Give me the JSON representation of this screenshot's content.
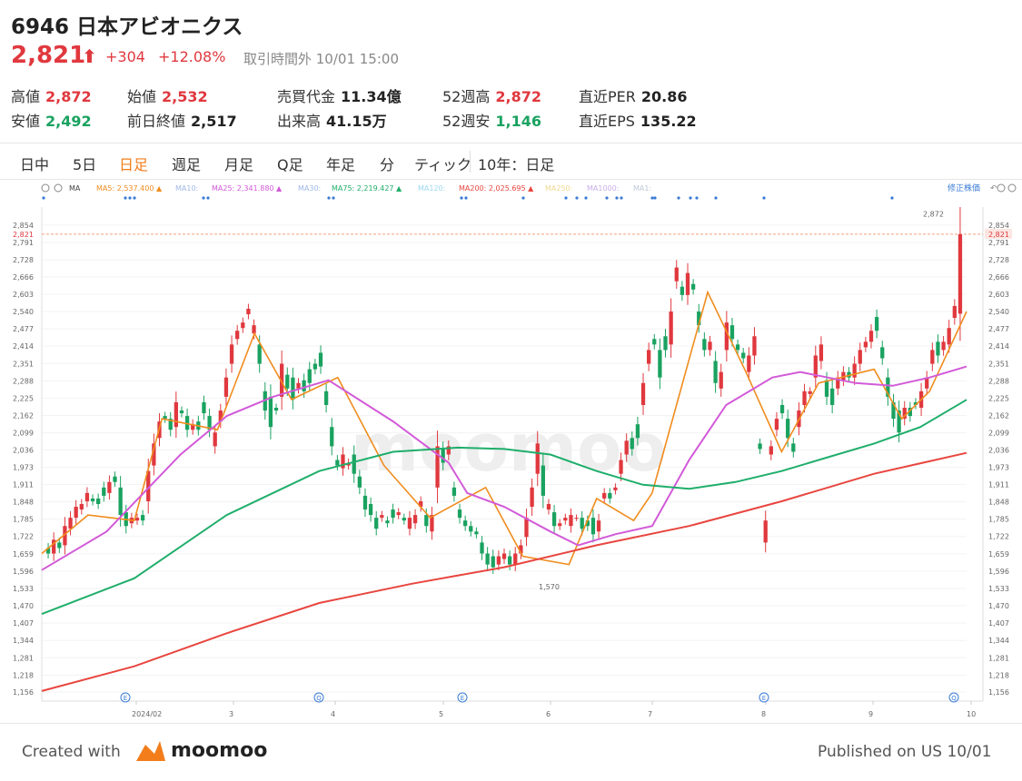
{
  "header": {
    "title": "6946 日本アビオニクス",
    "price": "2,821",
    "arrow": "⬆",
    "change": "+304",
    "change_pct": "+12.08%",
    "status": "取引時間外 10/01 15:00",
    "up_color": "#e0383e",
    "down_color": "#1aa260"
  },
  "stats": [
    {
      "label": "高値",
      "value": "2,872",
      "tone": "up"
    },
    {
      "label": "始値",
      "value": "2,532",
      "tone": "up"
    },
    {
      "label": "売買代金",
      "value": "11.34億",
      "tone": "neutral"
    },
    {
      "label": "52週高",
      "value": "2,872",
      "tone": "up"
    },
    {
      "label": "直近PER",
      "value": "20.86",
      "tone": "neutral"
    },
    {
      "label": "安値",
      "value": "2,492",
      "tone": "down"
    },
    {
      "label": "前日終値",
      "value": "2,517",
      "tone": "neutral"
    },
    {
      "label": "出来高",
      "value": "41.15万",
      "tone": "neutral"
    },
    {
      "label": "52週安",
      "value": "1,146",
      "tone": "down"
    },
    {
      "label": "直近EPS",
      "value": "135.22",
      "tone": "neutral"
    }
  ],
  "tabs": [
    "日中",
    "5日",
    "日足",
    "週足",
    "月足",
    "Q足",
    "年足",
    "分",
    "ティック"
  ],
  "active_tab": "日足",
  "range_label": "10年：日足",
  "legend": {
    "ma_label": "MA",
    "items": [
      {
        "text": "MA5: 2,537.400 ▲",
        "color": "#f08c1e"
      },
      {
        "text": "MA10:",
        "color": "#9fb8e6"
      },
      {
        "text": "MA25: 2,341.880 ▲",
        "color": "#d25ad8"
      },
      {
        "text": "MA30:",
        "color": "#9fb8e6"
      },
      {
        "text": "MA75: 2,219.427 ▲",
        "color": "#1fae6a"
      },
      {
        "text": "MA120:",
        "color": "#9fd8f0"
      },
      {
        "text": "MA200: 2,025.695 ▲",
        "color": "#e8463f"
      },
      {
        "text": "MA250:",
        "color": "#f0d890"
      },
      {
        "text": "MA1000:",
        "color": "#c8b0e8"
      },
      {
        "text": "MA1:",
        "color": "#c0c8d8"
      }
    ],
    "adjusted": "修正株価"
  },
  "watermark": "moomoo",
  "footer": {
    "created": "Created with",
    "brand": "moomoo",
    "published": "Published on US 10/01"
  },
  "chart_data": {
    "type": "candlestick",
    "y_ticks": [
      "2,854",
      "2,791",
      "2,728",
      "2,666",
      "2,603",
      "2,540",
      "2,477",
      "2,414",
      "2,351",
      "2,288",
      "2,225",
      "2,162",
      "2,099",
      "2,036",
      "1,973",
      "1,911",
      "1,848",
      "1,785",
      "1,722",
      "1,659",
      "1,596",
      "1,533",
      "1,470",
      "1,407",
      "1,344",
      "1,281",
      "1,218",
      "1,156"
    ],
    "ylim": [
      1130,
      2900
    ],
    "x_labels": [
      "2024/02",
      "3",
      "4",
      "5",
      "6",
      "7",
      "8",
      "9",
      "10"
    ],
    "current_price": 2821,
    "current_price_label": "2,821",
    "annotations": [
      {
        "text": "2,872",
        "value": 2872
      },
      {
        "text": "1,570",
        "value": 1570
      }
    ],
    "event_markers": [
      "E",
      "Q",
      "E",
      "E",
      "Q"
    ],
    "candles_approx": [
      [
        1680,
        1660
      ],
      [
        1660,
        1710
      ],
      [
        1700,
        1680
      ],
      [
        1690,
        1760
      ],
      [
        1750,
        1790
      ],
      [
        1790,
        1830
      ],
      [
        1820,
        1840
      ],
      [
        1850,
        1880
      ],
      [
        1860,
        1850
      ],
      [
        1860,
        1840
      ],
      [
        1900,
        1870
      ],
      [
        1880,
        1920
      ],
      [
        1940,
        1920
      ],
      [
        1900,
        1800
      ],
      [
        1810,
        1760
      ],
      [
        1770,
        1790
      ],
      [
        1780,
        1790
      ],
      [
        1800,
        1780
      ],
      [
        1850,
        1960
      ],
      [
        1980,
        2060
      ],
      [
        2080,
        2140
      ],
      [
        2160,
        2150
      ],
      [
        2150,
        2110
      ],
      [
        2120,
        2210
      ],
      [
        2180,
        2170
      ],
      [
        2160,
        2110
      ],
      [
        2110,
        2130
      ],
      [
        2140,
        2110
      ],
      [
        2210,
        2170
      ],
      [
        2160,
        2110
      ],
      [
        2050,
        2100
      ],
      [
        2140,
        2180
      ],
      [
        2230,
        2300
      ],
      [
        2350,
        2420
      ],
      [
        2440,
        2470
      ],
      [
        2480,
        2500
      ],
      [
        2530,
        2550
      ],
      [
        2460,
        2490
      ],
      [
        2420,
        2350
      ],
      [
        2250,
        2180
      ],
      [
        2230,
        2120
      ],
      [
        2190,
        2180
      ],
      [
        2230,
        2350
      ],
      [
        2310,
        2260
      ],
      [
        2300,
        2220
      ],
      [
        2260,
        2280
      ],
      [
        2290,
        2250
      ],
      [
        2330,
        2280
      ],
      [
        2350,
        2330
      ],
      [
        2390,
        2340
      ],
      [
        2250,
        2200
      ],
      [
        2120,
        2050
      ],
      [
        2000,
        1980
      ],
      [
        1970,
        2020
      ],
      [
        1980,
        1990
      ],
      [
        2020,
        1950
      ],
      [
        1940,
        1900
      ],
      [
        1870,
        1820
      ],
      [
        1840,
        1800
      ],
      [
        1790,
        1750
      ],
      [
        1790,
        1800
      ],
      [
        1780,
        1770
      ],
      [
        1820,
        1790
      ],
      [
        1800,
        1810
      ],
      [
        1790,
        1780
      ],
      [
        1750,
        1790
      ],
      [
        1770,
        1800
      ],
      [
        1830,
        1850
      ],
      [
        1800,
        1760
      ],
      [
        1740,
        1800
      ],
      [
        1900,
        2050
      ],
      [
        2040,
        1990
      ],
      [
        2020,
        2050
      ],
      [
        1900,
        1870
      ],
      [
        1820,
        1790
      ],
      [
        1780,
        1760
      ],
      [
        1760,
        1740
      ],
      [
        1740,
        1730
      ],
      [
        1700,
        1660
      ],
      [
        1660,
        1620
      ],
      [
        1650,
        1610
      ],
      [
        1620,
        1650
      ],
      [
        1640,
        1660
      ],
      [
        1650,
        1620
      ],
      [
        1620,
        1660
      ],
      [
        1660,
        1690
      ],
      [
        1720,
        1790
      ],
      [
        1830,
        1900
      ],
      [
        1950,
        2060
      ],
      [
        1980,
        1870
      ],
      [
        1820,
        1840
      ],
      [
        1810,
        1760
      ],
      [
        1760,
        1770
      ],
      [
        1780,
        1790
      ],
      [
        1760,
        1800
      ],
      [
        1790,
        1790
      ],
      [
        1790,
        1750
      ],
      [
        1780,
        1760
      ],
      [
        1790,
        1730
      ],
      [
        1740,
        1780
      ],
      [
        1860,
        1880
      ],
      [
        1880,
        1860
      ],
      [
        1890,
        1900
      ],
      [
        1950,
        2000
      ],
      [
        2020,
        2070
      ],
      [
        2080,
        2040
      ],
      [
        2130,
        2080
      ],
      [
        2200,
        2280
      ],
      [
        2350,
        2400
      ],
      [
        2440,
        2420
      ],
      [
        2400,
        2300
      ],
      [
        2450,
        2400
      ],
      [
        2420,
        2540
      ],
      [
        2650,
        2700
      ],
      [
        2630,
        2600
      ],
      [
        2600,
        2680
      ],
      [
        2640,
        2620
      ],
      [
        2540,
        2490
      ],
      [
        2440,
        2400
      ],
      [
        2400,
        2430
      ],
      [
        2360,
        2280
      ],
      [
        2260,
        2320
      ],
      [
        2400,
        2500
      ],
      [
        2490,
        2440
      ],
      [
        2420,
        2400
      ],
      [
        2390,
        2370
      ],
      [
        2320,
        2380
      ],
      [
        2380,
        2450
      ],
      [
        2060,
        2040
      ],
      [
        1700,
        1780
      ],
      [
        2020,
        2050
      ],
      [
        2110,
        2150
      ],
      [
        2200,
        2170
      ],
      [
        2150,
        2080
      ],
      [
        2060,
        2030
      ],
      [
        2120,
        2180
      ],
      [
        2200,
        2250
      ],
      [
        2240,
        2250
      ],
      [
        2300,
        2380
      ],
      [
        2360,
        2420
      ],
      [
        2290,
        2230
      ],
      [
        2260,
        2200
      ],
      [
        2260,
        2300
      ],
      [
        2290,
        2320
      ],
      [
        2320,
        2300
      ],
      [
        2300,
        2350
      ],
      [
        2350,
        2400
      ],
      [
        2410,
        2430
      ],
      [
        2430,
        2470
      ],
      [
        2520,
        2470
      ],
      [
        2410,
        2370
      ],
      [
        2300,
        2230
      ],
      [
        2210,
        2150
      ],
      [
        2180,
        2100
      ],
      [
        2150,
        2190
      ],
      [
        2190,
        2160
      ],
      [
        2210,
        2200
      ],
      [
        2190,
        2250
      ],
      [
        2260,
        2300
      ],
      [
        2350,
        2400
      ],
      [
        2430,
        2380
      ],
      [
        2400,
        2430
      ],
      [
        2420,
        2480
      ],
      [
        2517,
        2560
      ],
      [
        2532,
        2821
      ]
    ],
    "series": [
      {
        "name": "MA5",
        "color": "#f08c1e",
        "points": [
          [
            0,
            1660
          ],
          [
            0.05,
            1800
          ],
          [
            0.1,
            1780
          ],
          [
            0.13,
            2150
          ],
          [
            0.19,
            2110
          ],
          [
            0.23,
            2460
          ],
          [
            0.27,
            2220
          ],
          [
            0.32,
            2300
          ],
          [
            0.37,
            1980
          ],
          [
            0.42,
            1790
          ],
          [
            0.48,
            1900
          ],
          [
            0.52,
            1650
          ],
          [
            0.57,
            1620
          ],
          [
            0.6,
            1860
          ],
          [
            0.64,
            1780
          ],
          [
            0.66,
            1880
          ],
          [
            0.72,
            2610
          ],
          [
            0.76,
            2330
          ],
          [
            0.8,
            2030
          ],
          [
            0.84,
            2280
          ],
          [
            0.9,
            2330
          ],
          [
            0.93,
            2150
          ],
          [
            0.96,
            2250
          ],
          [
            1,
            2540
          ]
        ]
      },
      {
        "name": "MA25",
        "color": "#d25ad8",
        "points": [
          [
            0,
            1600
          ],
          [
            0.07,
            1740
          ],
          [
            0.15,
            2020
          ],
          [
            0.2,
            2160
          ],
          [
            0.25,
            2230
          ],
          [
            0.31,
            2290
          ],
          [
            0.38,
            2140
          ],
          [
            0.44,
            1990
          ],
          [
            0.46,
            1880
          ],
          [
            0.5,
            1830
          ],
          [
            0.55,
            1740
          ],
          [
            0.58,
            1690
          ],
          [
            0.62,
            1730
          ],
          [
            0.66,
            1760
          ],
          [
            0.7,
            2000
          ],
          [
            0.74,
            2200
          ],
          [
            0.79,
            2300
          ],
          [
            0.82,
            2320
          ],
          [
            0.88,
            2280
          ],
          [
            0.92,
            2270
          ],
          [
            0.96,
            2300
          ],
          [
            1,
            2340
          ]
        ]
      },
      {
        "name": "MA75",
        "color": "#1fae6a",
        "points": [
          [
            0,
            1440
          ],
          [
            0.1,
            1570
          ],
          [
            0.2,
            1800
          ],
          [
            0.3,
            1960
          ],
          [
            0.38,
            2030
          ],
          [
            0.45,
            2045
          ],
          [
            0.5,
            2040
          ],
          [
            0.55,
            2020
          ],
          [
            0.6,
            1960
          ],
          [
            0.65,
            1910
          ],
          [
            0.7,
            1895
          ],
          [
            0.75,
            1920
          ],
          [
            0.8,
            1960
          ],
          [
            0.85,
            2010
          ],
          [
            0.9,
            2060
          ],
          [
            0.95,
            2120
          ],
          [
            1,
            2219
          ]
        ]
      },
      {
        "name": "MA200",
        "color": "#e8463f",
        "points": [
          [
            0,
            1160
          ],
          [
            0.1,
            1250
          ],
          [
            0.2,
            1370
          ],
          [
            0.3,
            1480
          ],
          [
            0.4,
            1550
          ],
          [
            0.5,
            1610
          ],
          [
            0.6,
            1690
          ],
          [
            0.7,
            1760
          ],
          [
            0.8,
            1850
          ],
          [
            0.9,
            1950
          ],
          [
            1,
            2026
          ]
        ]
      }
    ]
  }
}
